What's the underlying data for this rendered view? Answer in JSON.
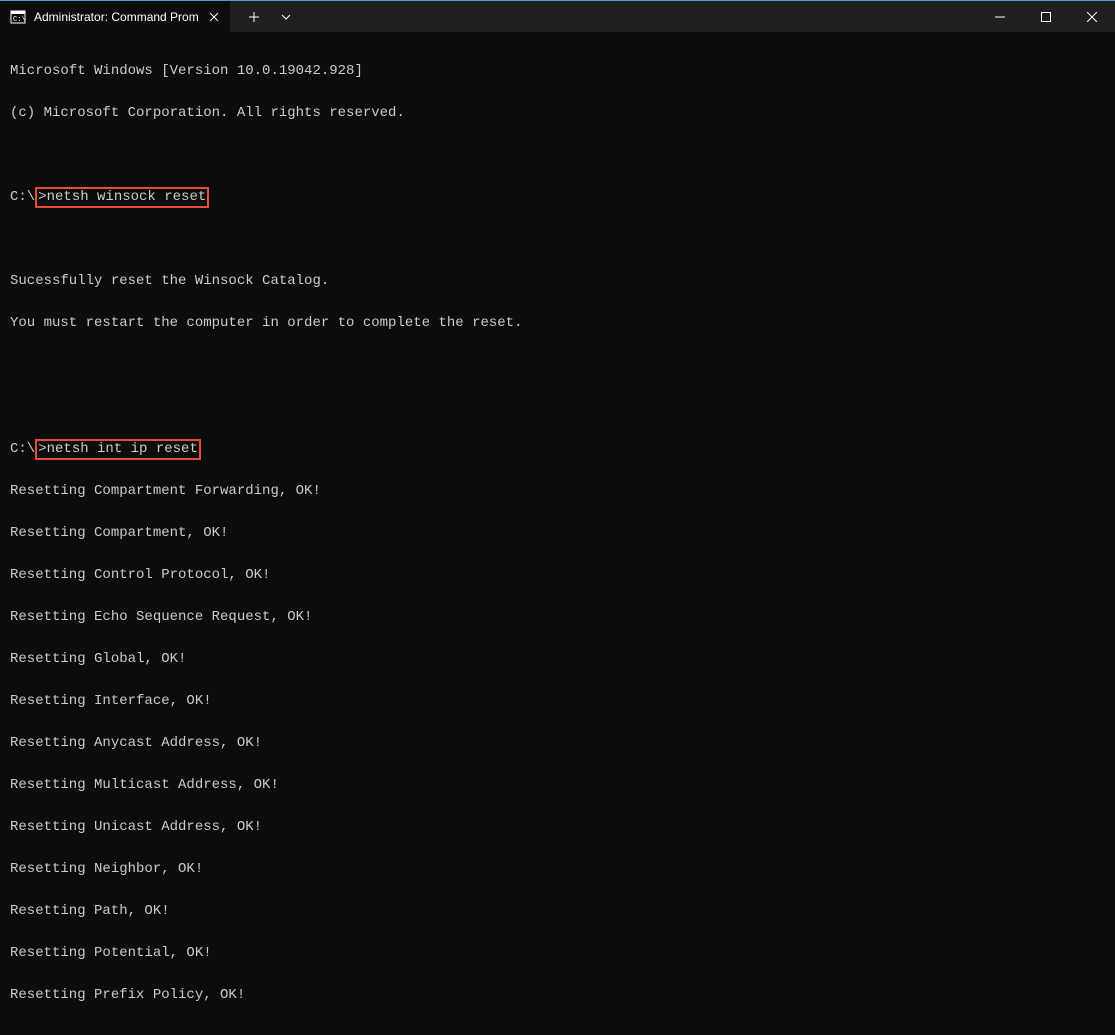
{
  "titlebar": {
    "tab_title": "Administrator: Command Promp",
    "new_tab_label": "+",
    "dropdown_label": "v"
  },
  "terminal": {
    "version_line": "Microsoft Windows [Version 10.0.19042.928]",
    "copyright_line": "(c) Microsoft Corporation. All rights reserved.",
    "prompt1_prefix": "C:\\",
    "command1": ">netsh winsock reset",
    "result1_line1": "Sucessfully reset the Winsock Catalog.",
    "result1_line2": "You must restart the computer in order to complete the reset.",
    "prompt2_prefix": "C:\\",
    "command2": ">netsh int ip reset",
    "reset_lines": [
      "Resetting Compartment Forwarding, OK!",
      "Resetting Compartment, OK!",
      "Resetting Control Protocol, OK!",
      "Resetting Echo Sequence Request, OK!",
      "Resetting Global, OK!",
      "Resetting Interface, OK!",
      "Resetting Anycast Address, OK!",
      "Resetting Multicast Address, OK!",
      "Resetting Unicast Address, OK!",
      "Resetting Neighbor, OK!",
      "Resetting Path, OK!",
      "Resetting Potential, OK!",
      "Resetting Prefix Policy, OK!"
    ]
  }
}
